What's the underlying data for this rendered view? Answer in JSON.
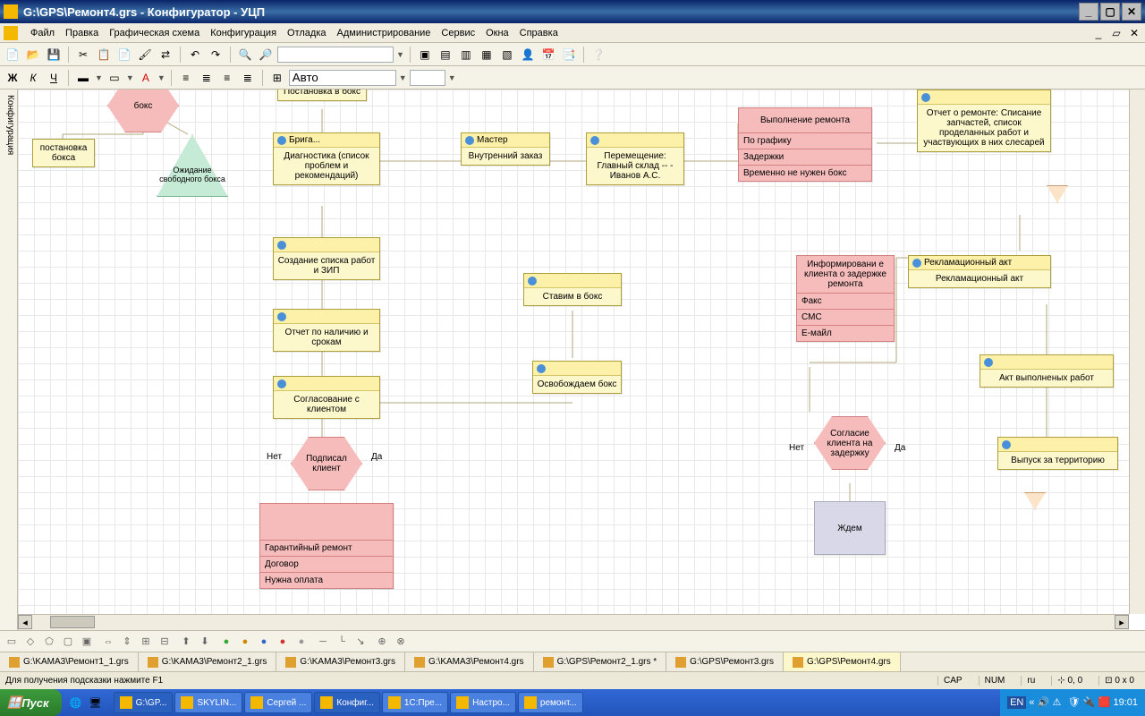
{
  "title": "G:\\GPS\\Ремонт4.grs - Конфигуратор - УЦП",
  "menu": [
    "Файл",
    "Правка",
    "Графическая схема",
    "Конфигурация",
    "Отладка",
    "Администрирование",
    "Сервис",
    "Окна",
    "Справка"
  ],
  "toolbar2_auto": "Авто",
  "sidetab": "Конфигурация",
  "nodes": {
    "topbox": "бокс",
    "tripark": "постановка\nбокса",
    "wait": "Ожидание\nсвободного\nбокса",
    "postanov": "Постановка в\nбокс",
    "briga_hdr": "Брига...",
    "briga": "Диагностика (список\nпроблем и\nрекомендаций)",
    "create": "Создание списка\nработ и ЗИП",
    "report_stock": "Отчет по наличию и\nсрокам",
    "agree": "Согласование с\nклиентом",
    "signed": "Подписал\nклиент",
    "no1": "Нет",
    "yes1": "Да",
    "gar_items": [
      "Гарантийный ремонт",
      "Договор",
      "Нужна оплата"
    ],
    "master_hdr": "Мастер",
    "master": "Внутренний\nзаказ",
    "move": "Перемещение:\nГлавный склад --\n- Иванов А.С.",
    "putbox": "Ставим в бокс",
    "freebox": "Освобождаем\nбокс",
    "repair_hdr": "Выполнение ремонта",
    "repair_items": [
      "По графику",
      "Задержки",
      "Временно не нужен бокс"
    ],
    "inform_hdr": "Информировани\nе клиента о\nзадержке\nремонта",
    "inform_items": [
      "Факс",
      "СМС",
      "Е-майл"
    ],
    "delay": "Согласие\nклиента\nна\nзадержку",
    "no2": "Нет",
    "yes2": "Да",
    "wait2": "Ждем",
    "repreport": "Отчет о ремонте:\nСписание запчастей,\nсписок проделанных\nработ и участвующих в\nних слесарей",
    "reclam_hdr": "Рекламационный акт",
    "reclam": "Рекламационный акт",
    "actdone": "Акт выполненых работ",
    "release": "Выпуск за территорию"
  },
  "bottomtabs": [
    "G:\\KAMA3\\Ремонт1_1.grs",
    "G:\\KAMA3\\Ремонт2_1.grs",
    "G:\\KAMA3\\Ремонт3.grs",
    "G:\\KAMA3\\Ремонт4.grs",
    "G:\\GPS\\Ремонт2_1.grs *",
    "G:\\GPS\\Ремонт3.grs",
    "G:\\GPS\\Ремонт4.grs"
  ],
  "status_hint": "Для получения подсказки нажмите F1",
  "status_cap": "CAP",
  "status_num": "NUM",
  "status_lang": "ru",
  "status_coord": "0, 0",
  "status_size": "0 x 0",
  "start": "Пуск",
  "tasks": [
    "G:\\GP...",
    "SKYLIN...",
    "Сергей ...",
    "Конфиг...",
    "1С:Пре...",
    "Настро...",
    "ремонт..."
  ],
  "tray_lang": "EN",
  "tray_time": "19:01"
}
